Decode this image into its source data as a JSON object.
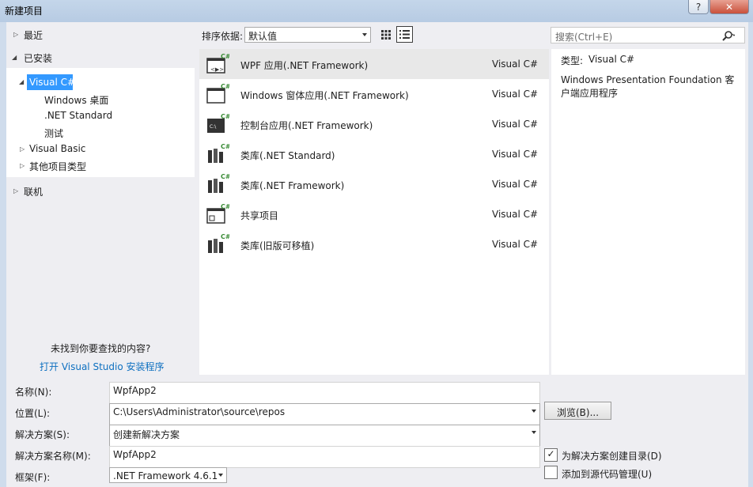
{
  "window": {
    "title": "新建项目",
    "help_icon": "question-icon",
    "close_icon": "close-icon"
  },
  "tree": {
    "recent": "最近",
    "installed": "已安装",
    "visual_csharp": "Visual C#",
    "windows_desktop": "Windows 桌面",
    "net_standard": ".NET Standard",
    "test": "测试",
    "visual_basic": "Visual Basic",
    "other_types": "其他项目类型",
    "online": "联机"
  },
  "toolbar": {
    "sort_label": "排序依据:",
    "sort_value": "默认值",
    "search_placeholder": "搜索(Ctrl+E)"
  },
  "templates": [
    {
      "name": "WPF 应用(.NET Framework)",
      "lang": "Visual C#",
      "icon": "wpf-app-icon"
    },
    {
      "name": "Windows 窗体应用(.NET Framework)",
      "lang": "Visual C#",
      "icon": "winforms-app-icon"
    },
    {
      "name": "控制台应用(.NET Framework)",
      "lang": "Visual C#",
      "icon": "console-app-icon"
    },
    {
      "name": "类库(.NET Standard)",
      "lang": "Visual C#",
      "icon": "class-library-icon"
    },
    {
      "name": "类库(.NET Framework)",
      "lang": "Visual C#",
      "icon": "class-library-icon"
    },
    {
      "name": "共享项目",
      "lang": "Visual C#",
      "icon": "shared-project-icon"
    },
    {
      "name": "类库(旧版可移植)",
      "lang": "Visual C#",
      "icon": "class-library-icon"
    }
  ],
  "details": {
    "type_label": "类型:",
    "type_value": "Visual C#",
    "description": "Windows Presentation Foundation 客户端应用程序"
  },
  "not_found": {
    "question": "未找到你要查找的内容?",
    "link": "打开 Visual Studio 安装程序"
  },
  "form": {
    "name_label": "名称(N):",
    "name_value": "WpfApp2",
    "location_label": "位置(L):",
    "location_value": "C:\\Users\\Administrator\\source\\repos",
    "browse_label": "浏览(B)...",
    "solution_label": "解决方案(S):",
    "solution_value": "创建新解决方案",
    "solution_name_label": "解决方案名称(M):",
    "solution_name_value": "WpfApp2",
    "framework_label": "框架(F):",
    "framework_value": ".NET Framework 4.6.1",
    "create_dir_label": "为解决方案创建目录(D)",
    "create_dir_checked": true,
    "source_control_label": "添加到源代码管理(U)",
    "source_control_checked": false
  }
}
